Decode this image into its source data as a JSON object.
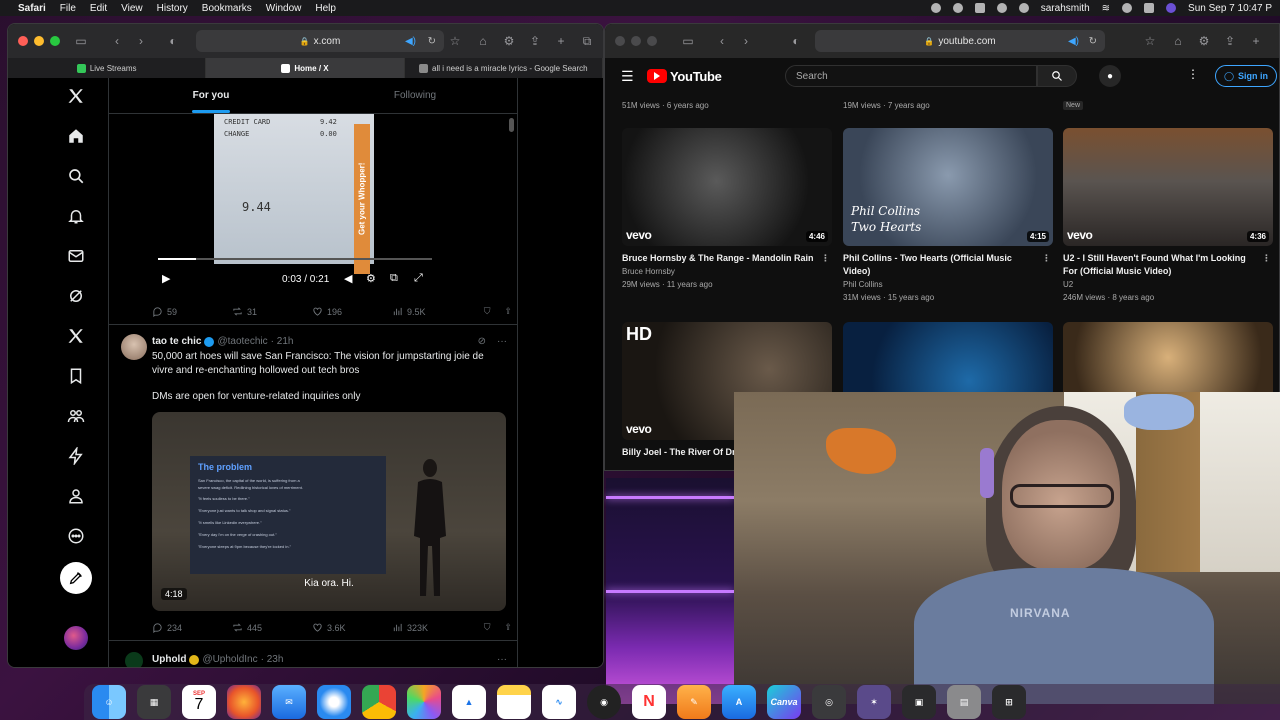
{
  "menubar": {
    "app": "Safari",
    "items": [
      "File",
      "Edit",
      "View",
      "History",
      "Bookmarks",
      "Window",
      "Help"
    ],
    "user": "sarahsmith",
    "clock": "Sun Sep 7  10:47 P"
  },
  "x_window": {
    "url": "x.com",
    "tabs": [
      {
        "label": "Live Streams",
        "color": "#34c759"
      },
      {
        "label": "Home / X",
        "color": "#ffffff"
      },
      {
        "label": "all i need is a miracle lyrics - Google Search",
        "color": "#8a8a8a"
      }
    ],
    "feed_tabs": {
      "for_you": "For you",
      "following": "Following"
    },
    "post1": {
      "receipt_line1": "CREDIT CARD",
      "receipt_val1": "9.42",
      "receipt_line2": "CHANGE",
      "receipt_val2": "0.00",
      "receipt_total": "9.44",
      "cup_text": "Get your Whopper!",
      "video_time": "0:03 / 0:21",
      "progress": 0.14,
      "replies": "59",
      "reposts": "31",
      "likes": "196",
      "views": "9.5K"
    },
    "post2": {
      "name": "tao te chic",
      "handle": "@taotechic",
      "time": "· 21h",
      "text": "50,000 art hoes will save San Francisco: The vision for jumpstarting joie de vivre and re-enchanting hollowed out tech bros",
      "text2": "DMs are open for venture-related inquiries only",
      "slide_title": "The problem",
      "slide_lines": [
        "San Francisco, the capital of the world, is suffering from a",
        "severe swag deficit. Redlining historical loves of merriment.",
        "\"It feels soulless to be there.\"",
        "\"Everyone just wants to talk shop and signal status.\"",
        "\"It smells like Linkedin everywhere.\"",
        "\"Every day I'm on the verge of crashing out.\"",
        "\"Everyone sleeps at 9pm because they're locked in.\""
      ],
      "caption": "Kia ora. Hi.",
      "duration": "4:18",
      "replies": "234",
      "reposts": "445",
      "likes": "3.6K",
      "views": "323K"
    },
    "post3": {
      "name": "Uphold",
      "handle": "@UpholdInc",
      "time": "· 23h"
    }
  },
  "yt_window": {
    "url": "youtube.com",
    "logo": "YouTube",
    "search_placeholder": "Search",
    "signin": "Sign in",
    "prev_row": [
      {
        "meta": "51M views · 6 years ago"
      },
      {
        "meta": "19M views · 7 years ago"
      },
      {
        "meta": "New"
      }
    ],
    "videos": [
      {
        "title": "Bruce Hornsby & The Range - Mandolin Rain",
        "channel": "Bruce Hornsby",
        "meta": "29M views · 11 years ago",
        "duration": "4:46",
        "brand": "vevo",
        "thumb_color": "#2a2a2a"
      },
      {
        "title": "Phil Collins - Two Hearts (Official Music Video)",
        "channel": "Phil Collins",
        "meta": "31M views · 15 years ago",
        "duration": "4:15",
        "brand": "Phil Collins",
        "brand2": "Two Hearts",
        "thumb_color": "#4a5a6e"
      },
      {
        "title": "U2 - I Still Haven't Found What I'm Looking For (Official Music Video)",
        "channel": "U2",
        "meta": "246M views · 8 years ago",
        "duration": "4:36",
        "brand": "vevo",
        "thumb_color": "#5a5450"
      }
    ],
    "row3": [
      {
        "title": "Billy Joel - The River Of Dr",
        "hd": "HD",
        "brand": "vevo"
      },
      {
        "title": ""
      },
      {
        "title": ""
      }
    ]
  },
  "webcam": {
    "shirt_text": "NIRVANA"
  },
  "dock": {
    "calendar_month": "SEP",
    "calendar_day": "7",
    "canva_label": "Canva"
  }
}
